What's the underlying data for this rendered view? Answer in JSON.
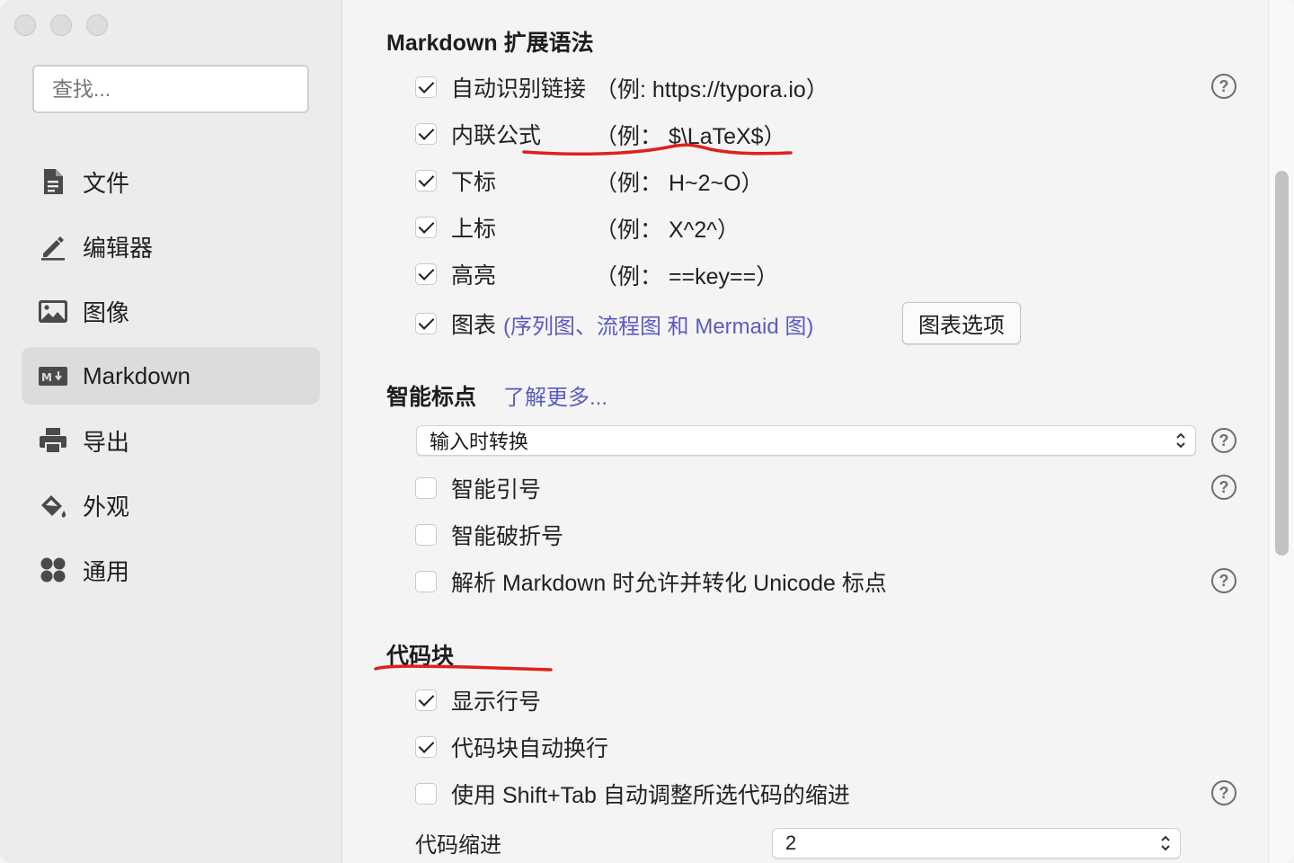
{
  "sidebar": {
    "search_placeholder": "查找...",
    "items": [
      {
        "label": "文件",
        "icon": "document-icon"
      },
      {
        "label": "编辑器",
        "icon": "pencil-icon"
      },
      {
        "label": "图像",
        "icon": "image-icon"
      },
      {
        "label": "Markdown",
        "icon": "markdown-icon",
        "active": true
      },
      {
        "label": "导出",
        "icon": "printer-icon"
      },
      {
        "label": "外观",
        "icon": "paint-bucket-icon"
      },
      {
        "label": "通用",
        "icon": "grid-icon"
      }
    ]
  },
  "markdown_ext": {
    "heading": "Markdown 扩展语法",
    "autolink": {
      "label": "自动识别链接",
      "example": "（例: https://typora.io）",
      "checked": true
    },
    "inline_math": {
      "label": "内联公式",
      "example": "（例：  $\\LaTeX$）",
      "checked": true
    },
    "subscript": {
      "label": "下标",
      "example": "（例：  H~2~O）",
      "checked": true
    },
    "superscript": {
      "label": "上标",
      "example": "（例：  X^2^）",
      "checked": true
    },
    "highlight": {
      "label": "高亮",
      "example": "（例：  ==key==）",
      "checked": true
    },
    "diagrams": {
      "label": "图表",
      "detail": "(序列图、流程图 和 Mermaid 图)",
      "checked": true
    },
    "diagram_options_button": "图表选项"
  },
  "smart_punct": {
    "heading": "智能标点",
    "learn_more": "了解更多...",
    "mode_select": "输入时转换",
    "smart_quotes": {
      "label": "智能引号",
      "checked": false
    },
    "smart_dashes": {
      "label": "智能破折号",
      "checked": false
    },
    "unicode_punct": {
      "label": "解析 Markdown 时允许并转化 Unicode 标点",
      "checked": false
    }
  },
  "code_block": {
    "heading": "代码块",
    "line_numbers": {
      "label": "显示行号",
      "checked": true
    },
    "wrap": {
      "label": "代码块自动换行",
      "checked": true
    },
    "shift_tab": {
      "label": "使用 Shift+Tab 自动调整所选代码的缩进",
      "checked": false
    },
    "indent_label": "代码缩进",
    "indent_value": "2"
  },
  "help_glyph": "?",
  "colors": {
    "accent_link": "#5b5bc0",
    "annotation": "#e0201a",
    "sidebar_bg": "#ececec",
    "main_bg": "#f4f4f4"
  }
}
